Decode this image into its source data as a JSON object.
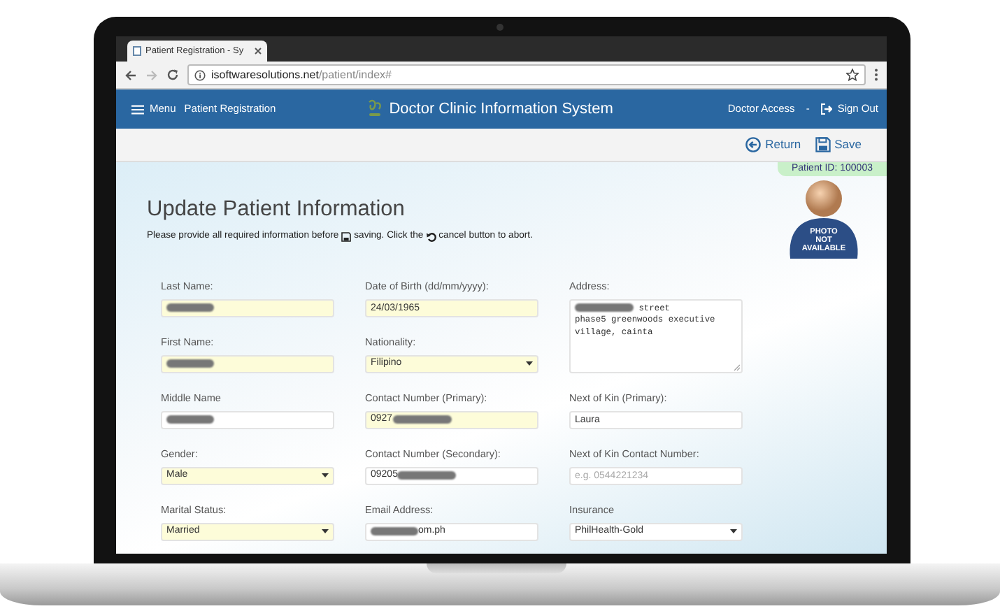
{
  "browser": {
    "tab_title": "Patient Registration - Sy",
    "url_host": "isoftwaresolutions.net",
    "url_path": "/patient/index#"
  },
  "navbar": {
    "menu": "Menu",
    "section": "Patient Registration",
    "title": "Doctor Clinic Information System",
    "user": "Doctor Access",
    "separator": "-",
    "sign_out": "Sign Out"
  },
  "toolbar": [
    {
      "kind": "return",
      "label": "Return"
    },
    {
      "kind": "save",
      "label": "Save"
    }
  ],
  "patient_id": "Patient ID: 100003",
  "photo_caption": [
    "PHOTO",
    "NOT",
    "AVAILABLE"
  ],
  "heading": "Update Patient Information",
  "instructions": [
    "Please provide all required information before",
    "saving. Click the",
    "cancel button to abort."
  ],
  "columns": [
    [
      {
        "label": "Last Name:",
        "kind": "text",
        "required": true,
        "redacted_before": true
      },
      {
        "label": "First Name:",
        "kind": "text",
        "required": true,
        "redacted_before": true
      },
      {
        "label": "Middle Name",
        "kind": "text",
        "required": false,
        "redacted_before": true
      },
      {
        "label": "Gender:",
        "kind": "select",
        "required": true,
        "value": "Male"
      },
      {
        "label": "Marital Status:",
        "kind": "select",
        "required": true,
        "value": "Married"
      }
    ],
    [
      {
        "label": "Date of Birth (dd/mm/yyyy):",
        "kind": "text",
        "required": true,
        "value": "24/03/1965"
      },
      {
        "label": "Nationality:",
        "kind": "select",
        "required": true,
        "value": "Filipino"
      },
      {
        "label": "Contact Number (Primary):",
        "kind": "text",
        "required": true,
        "value": "0927",
        "redacted_after": true
      },
      {
        "label": "Contact Number (Secondary):",
        "kind": "text",
        "required": false,
        "value": "09205",
        "redacted_after": true
      },
      {
        "label": "Email Address:",
        "kind": "text",
        "required": false,
        "value": "om.ph",
        "redacted_before": true
      }
    ],
    [
      {
        "label": "Address:",
        "kind": "textarea",
        "required": false,
        "value": "street\nphase5 greenwoods executive\nvillage, cainta",
        "redacted_before": true
      },
      {
        "label": "Next of Kin (Primary):",
        "kind": "text",
        "required": false,
        "value": "Laura"
      },
      {
        "label": "Next of Kin Contact Number:",
        "kind": "text",
        "required": false,
        "placeholder": "e.g. 0544221234"
      },
      {
        "label": "Insurance",
        "kind": "select",
        "required": false,
        "value": "PhilHealth-Gold"
      }
    ]
  ]
}
